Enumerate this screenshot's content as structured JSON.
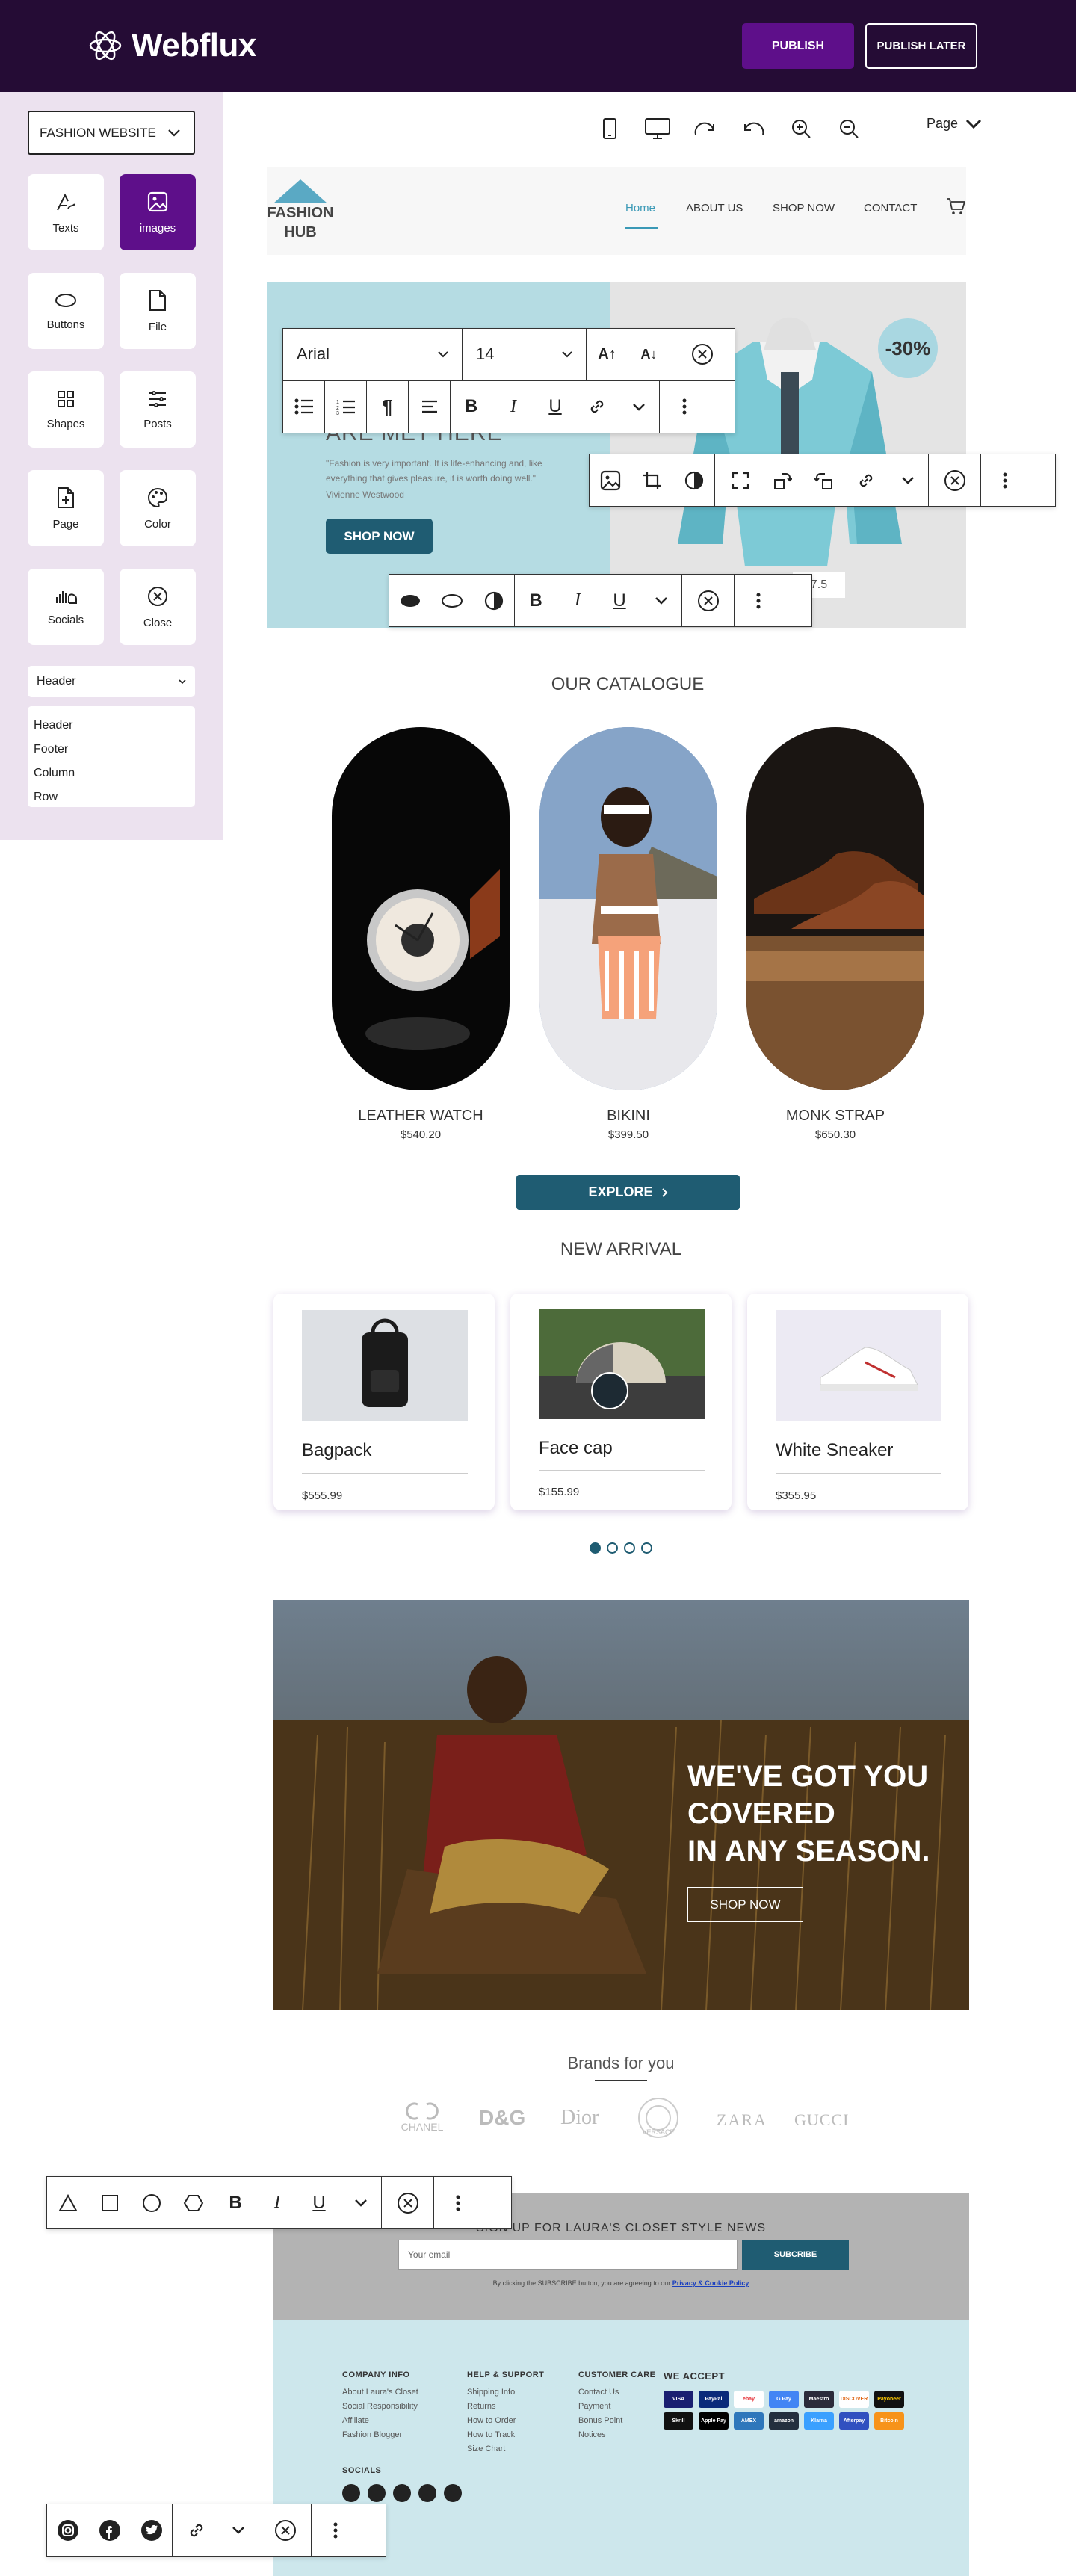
{
  "app": {
    "name": "Webflux",
    "publish_label": "PUBLISH",
    "publish_later_label": "PUBLISH LATER"
  },
  "sidebar": {
    "project": "FASHION WEBSITE",
    "tools": [
      {
        "label": "Texts",
        "icon": "text-pen-icon"
      },
      {
        "label": "images",
        "icon": "image-icon"
      },
      {
        "label": "Buttons",
        "icon": "button-oval-icon"
      },
      {
        "label": "File",
        "icon": "file-icon"
      },
      {
        "label": "Shapes",
        "icon": "shapes-grid-icon"
      },
      {
        "label": "Posts",
        "icon": "posts-icon"
      },
      {
        "label": "Page",
        "icon": "page-icon"
      },
      {
        "label": "Color",
        "icon": "palette-icon"
      },
      {
        "label": "Socials",
        "icon": "socials-icon"
      },
      {
        "label": "Close",
        "icon": "close-circle-icon"
      }
    ],
    "section_select": "Header",
    "sections": [
      "Header",
      "Footer",
      "Column",
      "Row"
    ]
  },
  "canvas": {
    "page_label": "Page"
  },
  "site": {
    "logo_line1": "FASHION",
    "logo_line2": "HUB",
    "nav": [
      "Home",
      "ABOUT US",
      "SHOP NOW",
      "CONTACT"
    ],
    "hero": {
      "heading": "ARE MET HERE",
      "quote": "\"Fashion is very important. It is life-enhancing and, like everything that gives pleasure, it is worth doing well.\"",
      "author": "Vivienne Westwood",
      "button": "SHOP NOW",
      "discount": "-30%",
      "price": "7.5"
    },
    "font_toolbar": {
      "font": "Arial",
      "size": "14"
    },
    "catalogue": {
      "title": "OUR CATALOGUE",
      "items": [
        {
          "name": "LEATHER WATCH",
          "price": "$540.20"
        },
        {
          "name": "BIKINI",
          "price": "$399.50"
        },
        {
          "name": "MONK STRAP",
          "price": "$650.30"
        }
      ],
      "button": "EXPLORE"
    },
    "arrivals": {
      "title": "NEW ARRIVAL",
      "items": [
        {
          "name": "Bagpack",
          "price": "$555.99"
        },
        {
          "name": "Face cap",
          "price": "$155.99"
        },
        {
          "name": "White Sneaker",
          "price": "$355.95"
        }
      ]
    },
    "banner": {
      "line1": "WE'VE GOT YOU",
      "line2": "COVERED",
      "line3": "IN ANY SEASON.",
      "button": "SHOP NOW"
    },
    "brands": {
      "title": "Brands for you",
      "items": [
        "CHANEL",
        "D&G",
        "Dior",
        "VERSACE",
        "ZARA",
        "GUCCI"
      ]
    },
    "newsletter": {
      "title": "SIGN UP FOR LAURA'S CLOSET  STYLE NEWS",
      "placeholder": "Your email",
      "button": "SUBCRIBE",
      "note": "By clicking the SUBSCRIBE button, you are agreeing to our",
      "note_link": "Privacy & Cookie Policy"
    },
    "footer": {
      "company": {
        "title": "COMPANY INFO",
        "items": [
          "About Laura's Closet",
          "Social Responsibility",
          "Affiliate",
          "Fashion Blogger"
        ]
      },
      "help": {
        "title": "HELP & SUPPORT",
        "items": [
          "Shipping Info",
          "Returns",
          "How to Order",
          "How to Track",
          "Size Chart"
        ]
      },
      "care": {
        "title": "CUSTOMER CARE",
        "items": [
          "Contact Us",
          "Payment",
          "Bonus Point",
          "Notices"
        ]
      },
      "accept": {
        "title": "WE ACCEPT",
        "cards": [
          "VISA",
          "PayPal",
          "ebay",
          "G Pay",
          "Maestro",
          "DISCOVER",
          "Payoneer",
          "Skrill",
          "Apple Pay",
          "AMEX",
          "amazon",
          "Klarna",
          "Afterpay",
          "Bitcoin"
        ]
      },
      "socials_title": "SOCIALS"
    }
  },
  "colors": {
    "brand_dark": "#250c35",
    "brand_purple": "#5e0f8a",
    "teal": "#1f5c72",
    "hero_blue": "#b5dce3"
  }
}
